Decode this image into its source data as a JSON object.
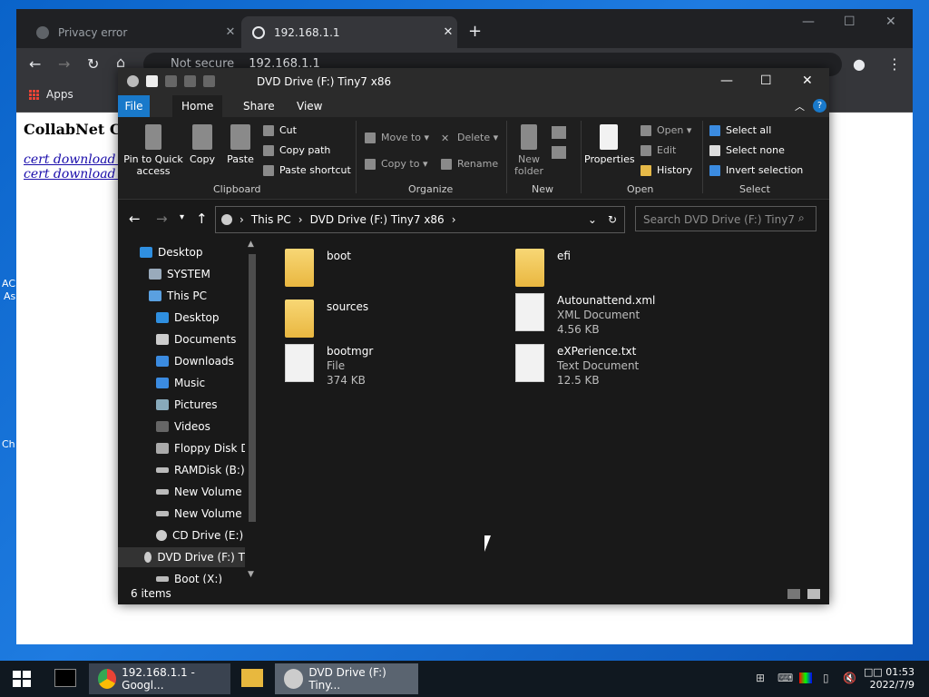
{
  "chrome": {
    "tabs": [
      {
        "label": "Privacy error",
        "close": "✕"
      },
      {
        "label": "192.168.1.1",
        "close": "✕"
      }
    ],
    "new_tab": "+",
    "address": {
      "security": "Not secure",
      "url": "192.168.1.1"
    },
    "bookmarks_apps": "Apps",
    "page": {
      "heading": "CollabNet Co",
      "links": [
        "cert download (",
        "cert download ("
      ]
    }
  },
  "desktop_fragments": [
    "AC",
    "As",
    "Ch"
  ],
  "explorer": {
    "title": "DVD Drive (F:) Tiny7 x86",
    "ribbon_tabs": [
      "File",
      "Home",
      "Share",
      "View"
    ],
    "clipboard": {
      "pin": "Pin to Quick access",
      "copy": "Copy",
      "paste": "Paste",
      "cut": "Cut",
      "copy_path": "Copy path",
      "paste_shortcut": "Paste shortcut",
      "label": "Clipboard"
    },
    "organize": {
      "move_to": "Move to",
      "copy_to": "Copy to",
      "delete": "Delete",
      "rename": "Rename",
      "label": "Organize"
    },
    "new": {
      "new_folder": "New folder",
      "label": "New"
    },
    "open": {
      "properties": "Properties",
      "open": "Open",
      "edit": "Edit",
      "history": "History",
      "label": "Open"
    },
    "select": {
      "select_all": "Select all",
      "select_none": "Select none",
      "invert": "Invert selection",
      "label": "Select"
    },
    "breadcrumb": [
      "This PC",
      "DVD Drive (F:) Tiny7 x86"
    ],
    "search_placeholder": "Search DVD Drive (F:) Tiny7 x86",
    "nav_items": [
      "Desktop",
      "SYSTEM",
      "This PC",
      "Desktop",
      "Documents",
      "Downloads",
      "Music",
      "Pictures",
      "Videos",
      "Floppy Disk Dri",
      "RAMDisk (B:)",
      "New Volume (C",
      "New Volume (D",
      "CD Drive (E:)",
      "DVD Drive (F:) T",
      "Boot (X:)"
    ],
    "files": [
      {
        "name": "boot",
        "type": "",
        "size": ""
      },
      {
        "name": "efi",
        "type": "",
        "size": ""
      },
      {
        "name": "sources",
        "type": "",
        "size": ""
      },
      {
        "name": "Autounattend.xml",
        "type": "XML Document",
        "size": "4.56 KB"
      },
      {
        "name": "bootmgr",
        "type": "File",
        "size": "374 KB"
      },
      {
        "name": "eXPerience.txt",
        "type": "Text Document",
        "size": "12.5 KB"
      }
    ],
    "status": "6 items"
  },
  "taskbar": {
    "items": [
      {
        "label": "192.168.1.1 - Googl..."
      },
      {
        "label": "DVD Drive (F:) Tiny..."
      }
    ],
    "time": "01:53",
    "time_prefix": "□□",
    "date": "2022/7/9"
  }
}
